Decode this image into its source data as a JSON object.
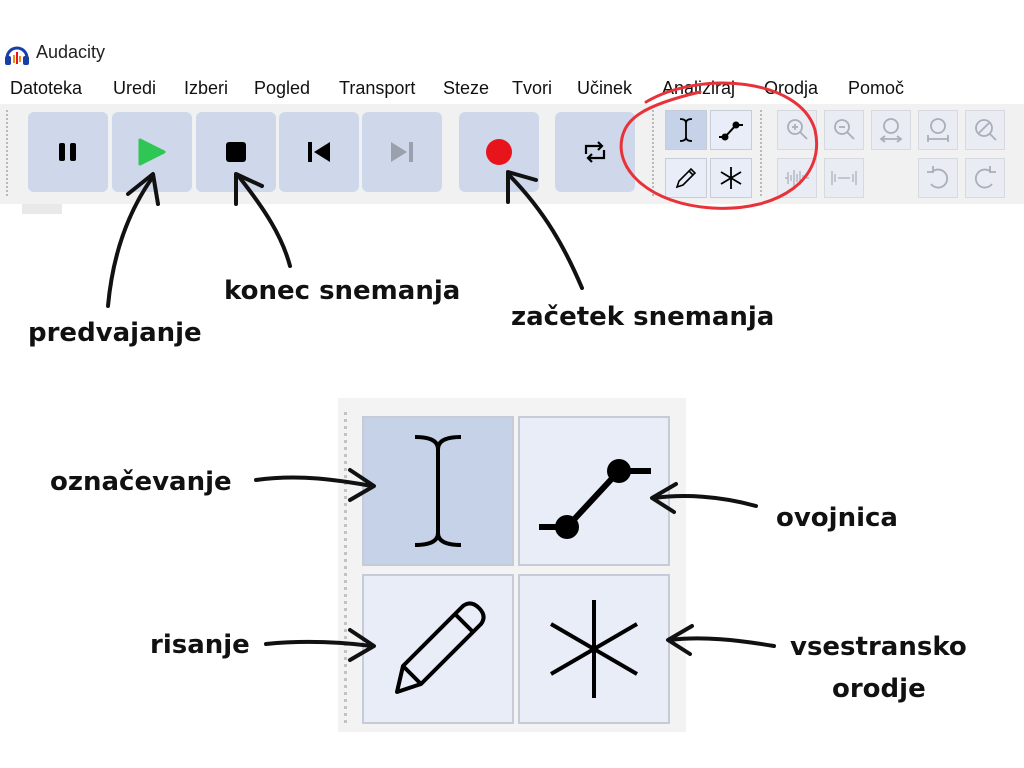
{
  "window": {
    "title": "Audacity"
  },
  "menu": [
    "Datoteka",
    "Uredi",
    "Izberi",
    "Pogled",
    "Transport",
    "Steze",
    "Tvori",
    "Učinek",
    "Analiziraj",
    "Orodja",
    "Pomoč"
  ],
  "transport_buttons": [
    {
      "name": "pause",
      "icon": "pause-icon"
    },
    {
      "name": "play",
      "icon": "play-icon",
      "color": "#2fc653"
    },
    {
      "name": "stop",
      "icon": "stop-icon"
    },
    {
      "name": "skip-to-start",
      "icon": "skip-start-icon"
    },
    {
      "name": "skip-to-end",
      "icon": "skip-end-icon",
      "disabled": true
    },
    {
      "name": "record",
      "icon": "record-icon",
      "color": "#e8141c"
    },
    {
      "name": "loop",
      "icon": "loop-icon"
    }
  ],
  "tools": [
    {
      "name": "selection",
      "icon": "i-beam-icon",
      "selected": true
    },
    {
      "name": "envelope",
      "icon": "envelope-icon"
    },
    {
      "name": "draw",
      "icon": "pencil-icon"
    },
    {
      "name": "multi",
      "icon": "asterisk-icon"
    }
  ],
  "edit_tools": [
    "zoom-in-icon",
    "zoom-out-icon",
    "fit-selection-icon",
    "fit-project-icon",
    "zoom-toggle-icon",
    "trim-icon",
    "silence-icon",
    "undo-icon",
    "redo-icon"
  ],
  "annotations": {
    "play": "predvajanje",
    "stop": "konec snemanja",
    "record": "začetek snemanja",
    "selection": "označevanje",
    "envelope": "ovojnica",
    "draw": "risanje",
    "multi_line1": "vsestransko",
    "multi_line2": "orodje"
  },
  "colors": {
    "highlight_circle": "#e8323a",
    "button_bg": "#cfd8ea",
    "tool_selected": "#c5d2e8"
  }
}
